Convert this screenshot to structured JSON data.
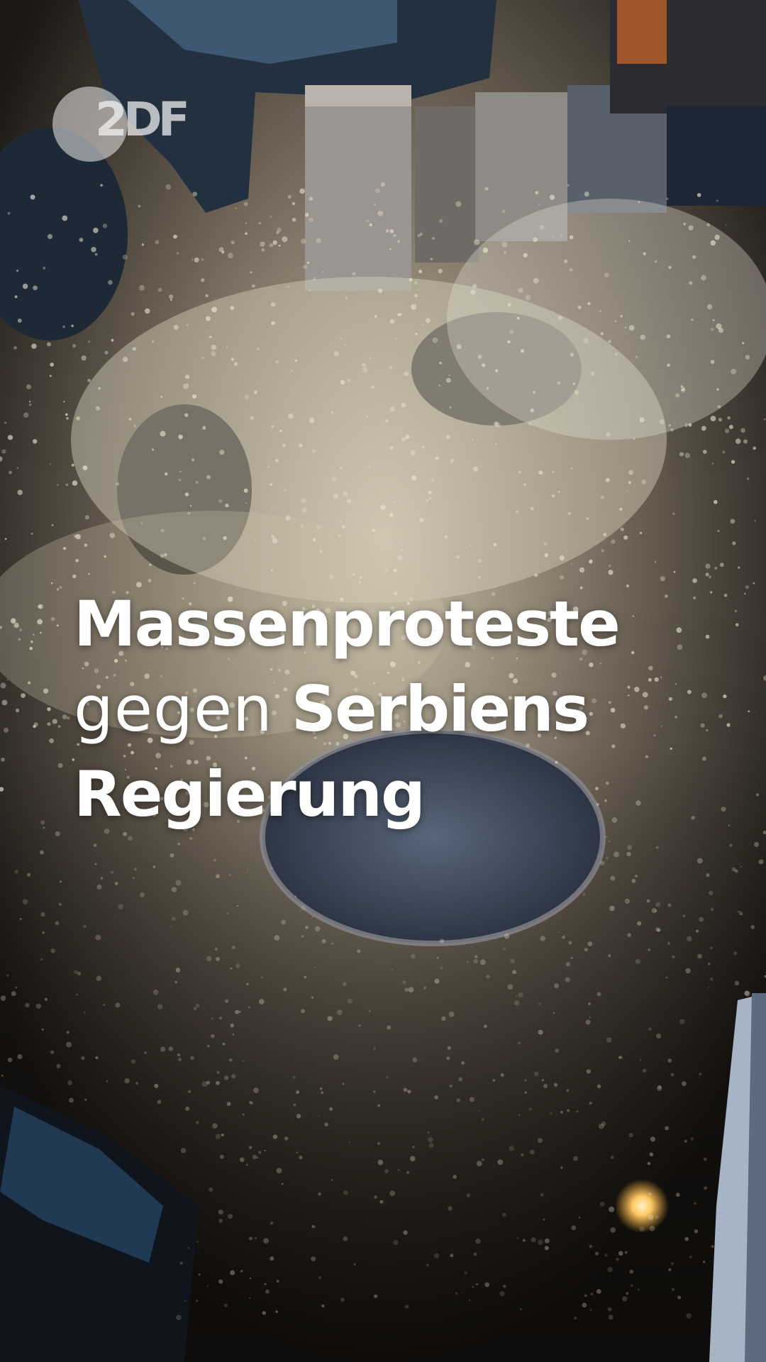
{
  "brand": {
    "logo_text": "2DF",
    "accent": "#ffffff"
  },
  "headline": {
    "line1": "Massenproteste",
    "line2_light": "gegen",
    "line2_bold": "Serbiens",
    "line3": "Regierung"
  },
  "colors": {
    "crowd_light": "#e9e2cf",
    "crowd_dark": "#1a1714",
    "lamp": "#ffd27a"
  }
}
